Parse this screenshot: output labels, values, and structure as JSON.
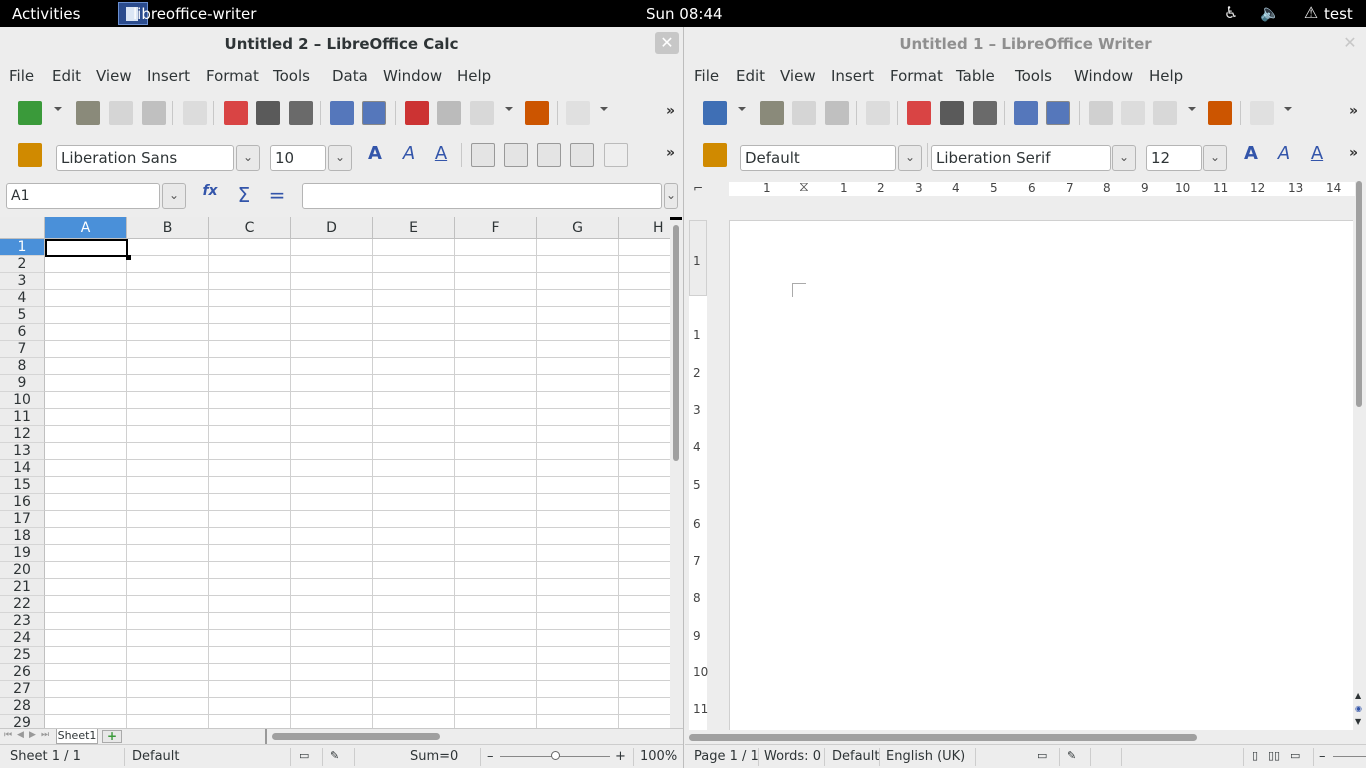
{
  "topbar": {
    "activities": "Activities",
    "app_name": "libreoffice-writer",
    "clock": "Sun 08:44",
    "user": "test"
  },
  "calc": {
    "title": "Untitled 2 – LibreOffice Calc",
    "menu": [
      "File",
      "Edit",
      "View",
      "Insert",
      "Format",
      "Tools",
      "Data",
      "Window",
      "Help"
    ],
    "font_name": "Liberation Sans",
    "font_size": "10",
    "name_box": "A1",
    "formula_value": "",
    "columns": [
      "A",
      "B",
      "C",
      "D",
      "E",
      "F",
      "G",
      "H"
    ],
    "rows": [
      "1",
      "2",
      "3",
      "4",
      "5",
      "6",
      "7",
      "8",
      "9",
      "10",
      "11",
      "12",
      "13",
      "14",
      "15",
      "16",
      "17",
      "18",
      "19",
      "20",
      "21",
      "22",
      "23",
      "24",
      "25",
      "26",
      "27",
      "28",
      "29"
    ],
    "sheet_tab": "Sheet1",
    "status": {
      "sheet": "Sheet 1 / 1",
      "style": "Default",
      "sum": "Sum=0",
      "zoom": "100%"
    },
    "icons": {
      "functions": "function-wizard-icon",
      "sum": "sum-icon",
      "equals": "formula-icon"
    }
  },
  "writer": {
    "title": "Untitled 1 – LibreOffice Writer",
    "menu": [
      "File",
      "Edit",
      "View",
      "Insert",
      "Format",
      "Table",
      "Tools",
      "Window",
      "Help"
    ],
    "para_style": "Default",
    "font_name": "Liberation Serif",
    "font_size": "12",
    "ruler_h": [
      "1",
      "1",
      "2",
      "3",
      "4",
      "5",
      "6",
      "7",
      "8",
      "9",
      "10",
      "11",
      "12",
      "13",
      "14"
    ],
    "ruler_v": [
      "1",
      "1",
      "2",
      "3",
      "4",
      "5",
      "6",
      "7",
      "8",
      "9",
      "10",
      "11"
    ],
    "status": {
      "page": "Page 1 / 1",
      "words": "Words: 0",
      "style": "Default",
      "lang": "English (UK)"
    }
  },
  "colors": {
    "selection": "#4a90d9",
    "topbar": "#000000"
  }
}
